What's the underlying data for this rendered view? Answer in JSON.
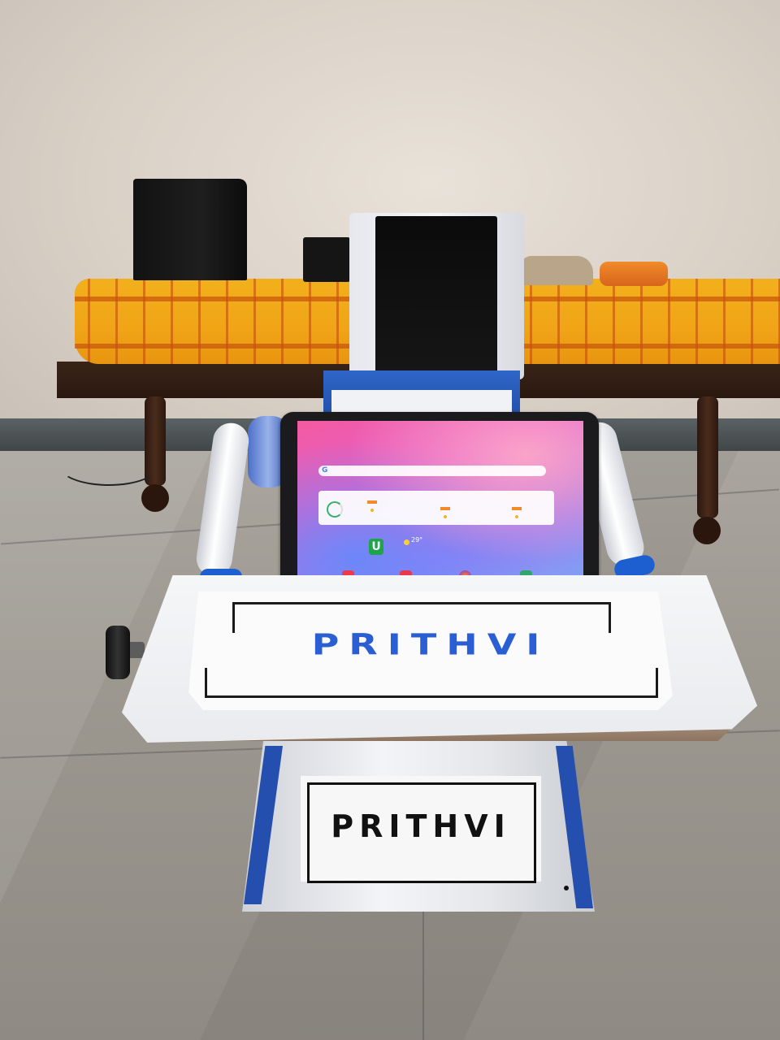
{
  "scene": {
    "front_sign_text": "PRITHVI",
    "base_sign_text": "PRITHVI",
    "tablet_weather_temp": "29°",
    "tablet_app_letter": "U"
  },
  "colors": {
    "wall": "#e2dad0",
    "bedsheet": "#f0a416",
    "robot_blue": "#2a5fd4",
    "robot_white": "#f4f5f8",
    "speaker_black": "#111111"
  },
  "icons": [
    "google-search-icon",
    "weather-gauge-icon",
    "sun-icon",
    "video-app-icon",
    "mail-app-icon",
    "browser-app-icon",
    "calendar-app-icon"
  ]
}
